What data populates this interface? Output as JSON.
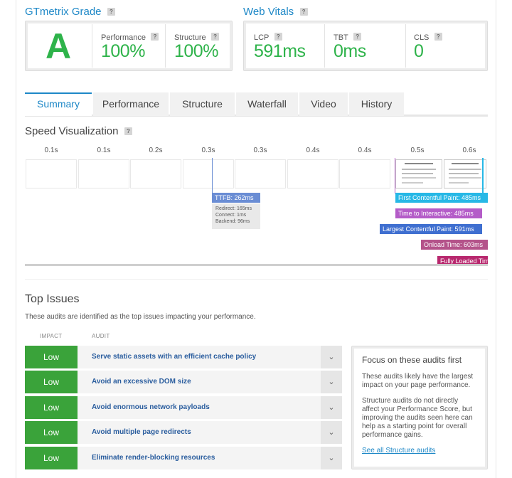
{
  "grade": {
    "title": "GTmetrix Grade",
    "letter": "A",
    "performance_label": "Performance",
    "performance_value": "100%",
    "structure_label": "Structure",
    "structure_value": "100%"
  },
  "vitals": {
    "title": "Web Vitals",
    "lcp_label": "LCP",
    "lcp_value": "591ms",
    "tbt_label": "TBT",
    "tbt_value": "0ms",
    "cls_label": "CLS",
    "cls_value": "0"
  },
  "help_glyph": "?",
  "tabs": [
    "Summary",
    "Performance",
    "Structure",
    "Waterfall",
    "Video",
    "History"
  ],
  "speed": {
    "title": "Speed Visualization",
    "ticks": [
      "0.1s",
      "0.1s",
      "0.2s",
      "0.3s",
      "0.3s",
      "0.4s",
      "0.4s",
      "0.5s",
      "0.6s"
    ],
    "ttfb": "TTFB: 262ms",
    "redirect": "Redirect: 165ms",
    "connect": "Connect: 1ms",
    "backend": "Backend: 96ms",
    "fcp": "First Contentful Paint: 485ms",
    "tti": "Time to Interactive: 485ms",
    "lcp": "Largest Contentful Paint: 591ms",
    "onload": "Onload Time: 603ms",
    "fully": "Fully Loaded Time"
  },
  "issues": {
    "title": "Top Issues",
    "subtitle": "These audits are identified as the top issues impacting your performance.",
    "impact_header": "IMPACT",
    "audit_header": "AUDIT",
    "rows": [
      {
        "impact": "Low",
        "audit": "Serve static assets with an efficient cache policy"
      },
      {
        "impact": "Low",
        "audit": "Avoid an excessive DOM size"
      },
      {
        "impact": "Low",
        "audit": "Avoid enormous network payloads"
      },
      {
        "impact": "Low",
        "audit": "Avoid multiple page redirects"
      },
      {
        "impact": "Low",
        "audit": "Eliminate render-blocking resources"
      }
    ]
  },
  "focus": {
    "title": "Focus on these audits first",
    "p1": "These audits likely have the largest impact on your page performance.",
    "p2": "Structure audits do not directly affect your Performance Score, but improving the audits seen here can help as a starting point for overall performance gains.",
    "link": "See all Structure audits"
  },
  "colors": {
    "accent": "#1e88c7",
    "grade_green": "#2eb34a",
    "low_green": "#3aa33a",
    "ttfb": "#6a8dd4",
    "fcp": "#27b8e6",
    "tti": "#b45cc8",
    "lcp": "#3f6fd0",
    "onload": "#b4538a",
    "fully": "#b8286e"
  }
}
